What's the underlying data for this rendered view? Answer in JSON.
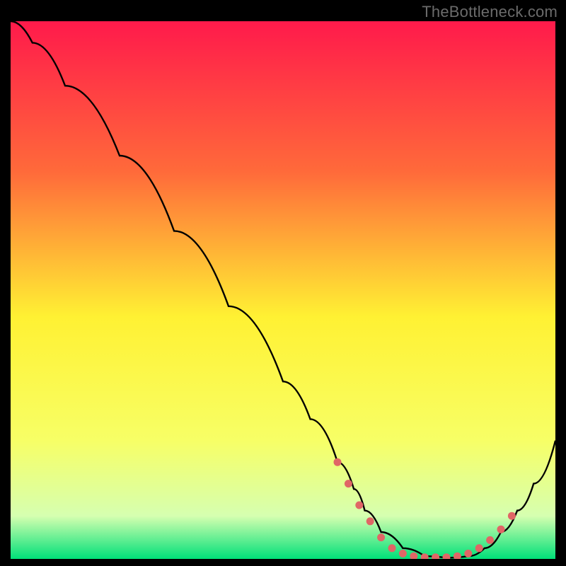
{
  "watermark": "TheBottleneck.com",
  "chart_data": {
    "type": "line",
    "title": "",
    "xlabel": "",
    "ylabel": "",
    "xlim": [
      0,
      100
    ],
    "ylim": [
      0,
      100
    ],
    "gradient_bg": {
      "top": "#ff1a4b",
      "q1": "#ff6a3a",
      "mid": "#fff133",
      "q3": "#f7ff66",
      "low": "#d6ffb0",
      "bottom": "#00e079"
    },
    "series": [
      {
        "name": "curve",
        "color": "#000000",
        "stroke_width": 2.4,
        "x": [
          0,
          4,
          10,
          20,
          30,
          40,
          50,
          55,
          60,
          63,
          65,
          68,
          72,
          76,
          80,
          84,
          87,
          90,
          93,
          96,
          100
        ],
        "y": [
          100,
          96,
          88,
          75,
          61,
          47,
          33,
          26,
          18,
          13,
          9,
          5,
          2,
          0.5,
          0.2,
          0.5,
          2,
          5,
          9,
          14,
          22
        ]
      }
    ],
    "markers": {
      "name": "dots",
      "color": "#e06666",
      "radius": 5.5,
      "x": [
        60,
        62,
        64,
        66,
        68,
        70,
        72,
        74,
        76,
        78,
        80,
        82,
        84,
        86,
        88,
        90,
        92
      ],
      "y": [
        18,
        14,
        10,
        7,
        4,
        2,
        1,
        0.5,
        0.3,
        0.3,
        0.3,
        0.5,
        1,
        2,
        3.5,
        5.5,
        8
      ]
    }
  }
}
